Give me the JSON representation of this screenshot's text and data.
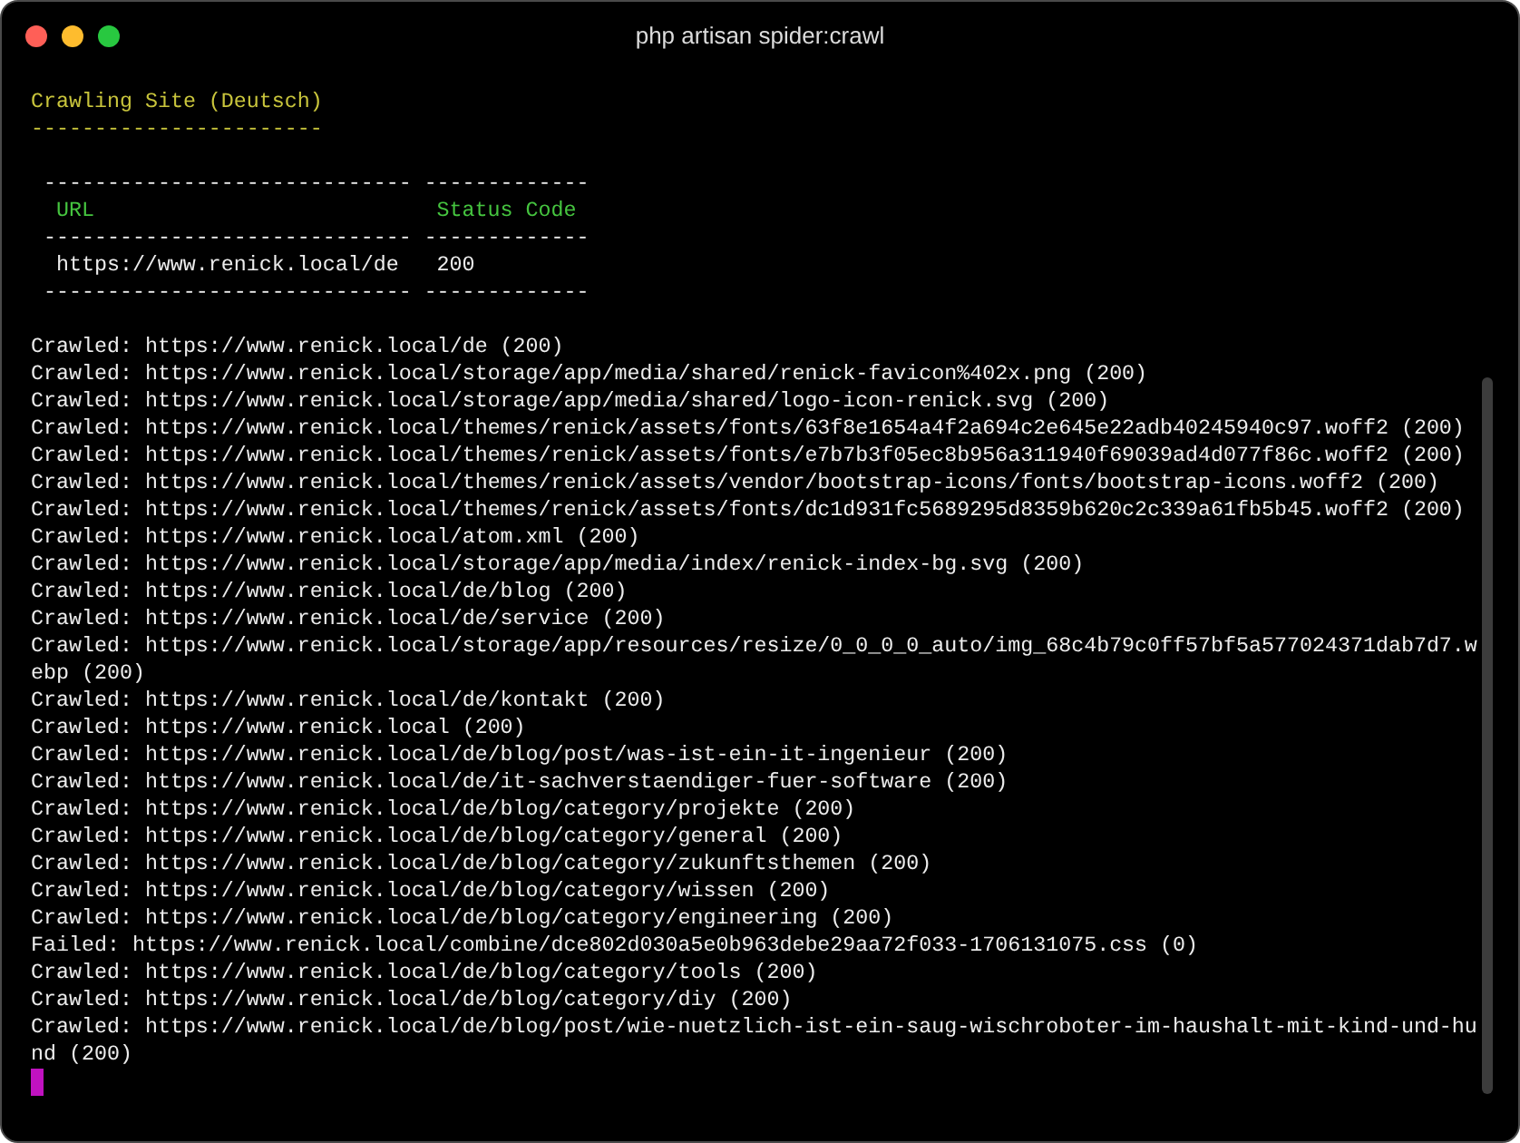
{
  "window": {
    "title": "php artisan spider:crawl"
  },
  "heading": {
    "text": "Crawling Site (Deutsch)",
    "underline": "-----------------------"
  },
  "table": {
    "columns": [
      "URL",
      "Status Code"
    ],
    "rows": [
      [
        "https://www.renick.local/de",
        "200"
      ]
    ],
    "rules": [
      [
        "-----------------------------",
        "-------------"
      ],
      [
        "-----------------------------",
        "-------------"
      ],
      [
        "-----------------------------",
        "-------------"
      ]
    ]
  },
  "log_lines": [
    "Crawled: https://www.renick.local/de (200)",
    "Crawled: https://www.renick.local/storage/app/media/shared/renick-favicon%402x.png (200)",
    "Crawled: https://www.renick.local/storage/app/media/shared/logo-icon-renick.svg (200)",
    "Crawled: https://www.renick.local/themes/renick/assets/fonts/63f8e1654a4f2a694c2e645e22adb40245940c97.woff2 (200)",
    "Crawled: https://www.renick.local/themes/renick/assets/fonts/e7b7b3f05ec8b956a311940f69039ad4d077f86c.woff2 (200)",
    "Crawled: https://www.renick.local/themes/renick/assets/vendor/bootstrap-icons/fonts/bootstrap-icons.woff2 (200)",
    "Crawled: https://www.renick.local/themes/renick/assets/fonts/dc1d931fc5689295d8359b620c2c339a61fb5b45.woff2 (200)",
    "Crawled: https://www.renick.local/atom.xml (200)",
    "Crawled: https://www.renick.local/storage/app/media/index/renick-index-bg.svg (200)",
    "Crawled: https://www.renick.local/de/blog (200)",
    "Crawled: https://www.renick.local/de/service (200)",
    "Crawled: https://www.renick.local/storage/app/resources/resize/0_0_0_0_auto/img_68c4b79c0ff57bf5a577024371dab7d7.webp (200)",
    "Crawled: https://www.renick.local/de/kontakt (200)",
    "Crawled: https://www.renick.local (200)",
    "Crawled: https://www.renick.local/de/blog/post/was-ist-ein-it-ingenieur (200)",
    "Crawled: https://www.renick.local/de/it-sachverstaendiger-fuer-software (200)",
    "Crawled: https://www.renick.local/de/blog/category/projekte (200)",
    "Crawled: https://www.renick.local/de/blog/category/general (200)",
    "Crawled: https://www.renick.local/de/blog/category/zukunftsthemen (200)",
    "Crawled: https://www.renick.local/de/blog/category/wissen (200)",
    "Crawled: https://www.renick.local/de/blog/category/engineering (200)",
    "Failed: https://www.renick.local/combine/dce802d030a5e0b963debe29aa72f033-1706131075.css (0)",
    "Crawled: https://www.renick.local/de/blog/category/tools (200)",
    "Crawled: https://www.renick.local/de/blog/category/diy (200)",
    "Crawled: https://www.renick.local/de/blog/post/wie-nuetzlich-ist-ein-saug-wischroboter-im-haushalt-mit-kind-und-hund (200)"
  ]
}
